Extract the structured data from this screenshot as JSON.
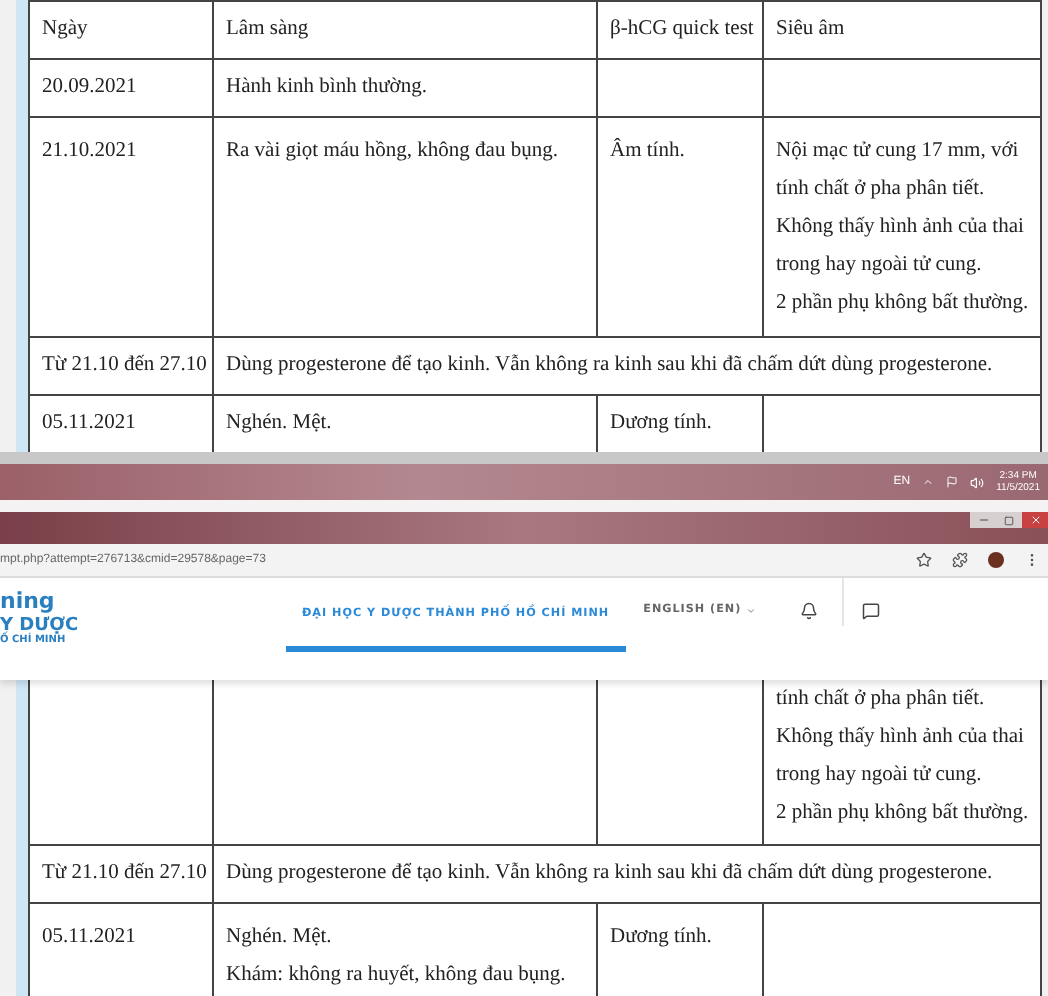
{
  "top_table": {
    "columns": [
      "Ngày",
      "Lâm sàng",
      "β-hCG quick test",
      "Siêu âm"
    ],
    "rows": [
      {
        "kind": "normal",
        "cells": [
          [
            "20.09.2021"
          ],
          [
            "Hành kinh bình thường."
          ],
          [],
          []
        ]
      },
      {
        "kind": "normal",
        "cells": [
          [
            "21.10.2021"
          ],
          [
            "Ra vài giọt máu hồng, không đau bụng."
          ],
          [
            "Âm tính."
          ],
          [
            "Nội mạc tử cung 17 mm, với",
            "tính chất ở pha phân tiết.",
            "Không thấy hình ảnh của thai",
            "trong hay ngoài tử cung.",
            "2 phần phụ không bất thường."
          ]
        ]
      },
      {
        "kind": "merged",
        "cells": [
          [
            "Từ 21.10 đến 27.10"
          ],
          [
            "Dùng progesterone để tạo kinh. Vẫn không ra kinh sau khi đã chấm dứt dùng progesterone."
          ]
        ]
      },
      {
        "kind": "normal",
        "cells": [
          [
            "05.11.2021"
          ],
          [
            "Nghén. Mệt."
          ],
          [
            "Dương tính."
          ],
          []
        ]
      }
    ]
  },
  "taskbar": {
    "language": "EN",
    "time": "2:34 PM",
    "date": "11/5/2021"
  },
  "browser": {
    "url": "mpt.php?attempt=276713&cmid=29578&page=73"
  },
  "site_header": {
    "logo_lines": [
      "ning",
      "Y DƯỢC",
      "Ố CHÍ MINH"
    ],
    "nav_link": {
      "label": "ĐẠI HỌC Y DƯỢC THÀNH PHỐ HỒ CHÍ MINH",
      "selected": true
    },
    "language_menu": "ENGLISH (EN)"
  },
  "bottom_table": {
    "rows": [
      {
        "kind": "normal",
        "cells": [
          [],
          [],
          [],
          [
            "tính chất ở pha phân tiết.",
            "Không thấy hình ảnh của thai",
            "trong hay ngoài tử cung.",
            "2 phần phụ không bất thường."
          ]
        ]
      },
      {
        "kind": "merged",
        "cells": [
          [
            "Từ 21.10 đến 27.10"
          ],
          [
            "Dùng progesterone để tạo kinh. Vẫn không ra kinh sau khi đã chấm dứt dùng progesterone."
          ]
        ]
      },
      {
        "kind": "normal",
        "cells": [
          [
            "05.11.2021"
          ],
          [
            "Nghén. Mệt.",
            "Khám: không ra huyết, không đau bụng."
          ],
          [
            "Dương tính."
          ],
          []
        ]
      }
    ]
  }
}
